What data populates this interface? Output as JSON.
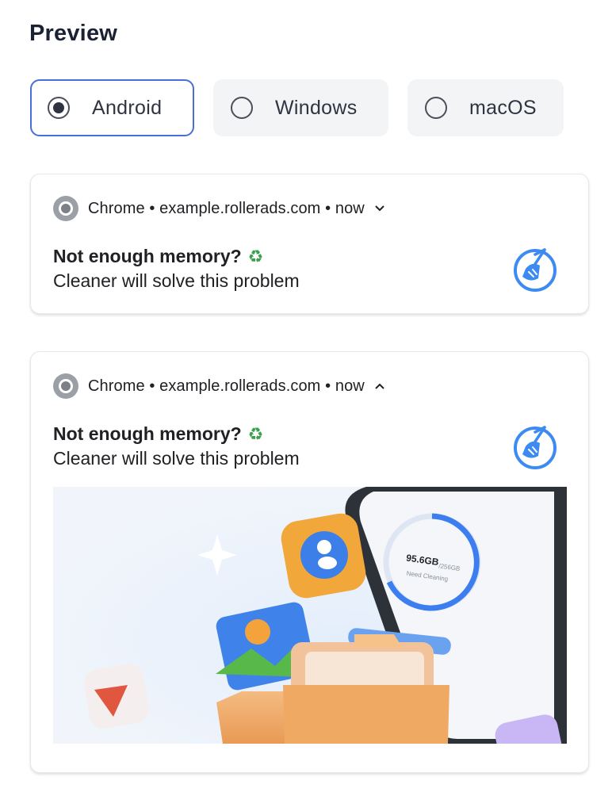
{
  "preview": {
    "title": "Preview"
  },
  "os_options": [
    {
      "label": "Android",
      "selected": true
    },
    {
      "label": "Windows",
      "selected": false
    },
    {
      "label": "macOS",
      "selected": false
    }
  ],
  "notifications": [
    {
      "source": "Chrome • example.rollerads.com • now",
      "expanded": false,
      "title": "Not enough memory?",
      "title_emoji": "recycle-icon",
      "body": "Cleaner will solve this problem",
      "icon": "broom-cleaner-icon"
    },
    {
      "source": "Chrome • example.rollerads.com • now",
      "expanded": true,
      "title": "Not enough memory?",
      "title_emoji": "recycle-icon",
      "body": "Cleaner will solve this problem",
      "icon": "broom-cleaner-icon",
      "image": {
        "description_icon": "phone-cleaner-illustration",
        "phone_storage_value": "95.6GB",
        "phone_storage_total": "/256GB",
        "phone_status": "Need Cleaning"
      }
    }
  ],
  "colors": {
    "selected_border": "#4a6fd4",
    "unselected_bg": "#f3f4f6",
    "icon_blue": "#3d8bf0",
    "recycle_green": "#3aa04a"
  }
}
